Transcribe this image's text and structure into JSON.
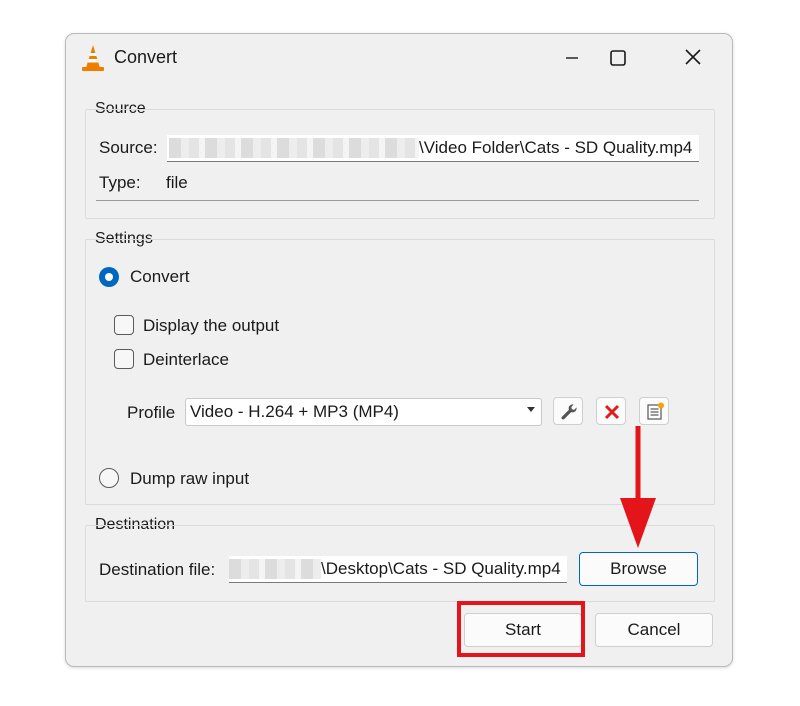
{
  "window": {
    "title": "Convert"
  },
  "source": {
    "group_label": "Source",
    "source_label": "Source:",
    "source_path_visible": "\\Video Folder\\Cats - SD Quality.mp4",
    "type_label": "Type:",
    "type_value": "file"
  },
  "settings": {
    "group_label": "Settings",
    "convert_label": "Convert",
    "convert_selected": true,
    "display_output_label": "Display the output",
    "display_output_checked": false,
    "deinterlace_label": "Deinterlace",
    "deinterlace_checked": false,
    "profile_label": "Profile",
    "profile_value": "Video - H.264 + MP3 (MP4)",
    "dump_raw_label": "Dump raw input",
    "dump_raw_selected": false
  },
  "destination": {
    "group_label": "Destination",
    "file_label": "Destination file:",
    "file_path_visible": "\\Desktop\\Cats - SD Quality.mp4",
    "browse_label": "Browse"
  },
  "buttons": {
    "start_label": "Start",
    "cancel_label": "Cancel"
  },
  "icons": {
    "app": "vlc-cone-icon",
    "minimize": "minimize-icon",
    "maximize": "maximize-icon",
    "close": "close-icon",
    "edit_profile": "wrench-icon",
    "delete_profile": "red-x-icon",
    "new_profile": "new-profile-icon"
  },
  "colors": {
    "accent": "#0067c0",
    "annotation": "#e4141b",
    "vlc_orange": "#f07c00"
  }
}
